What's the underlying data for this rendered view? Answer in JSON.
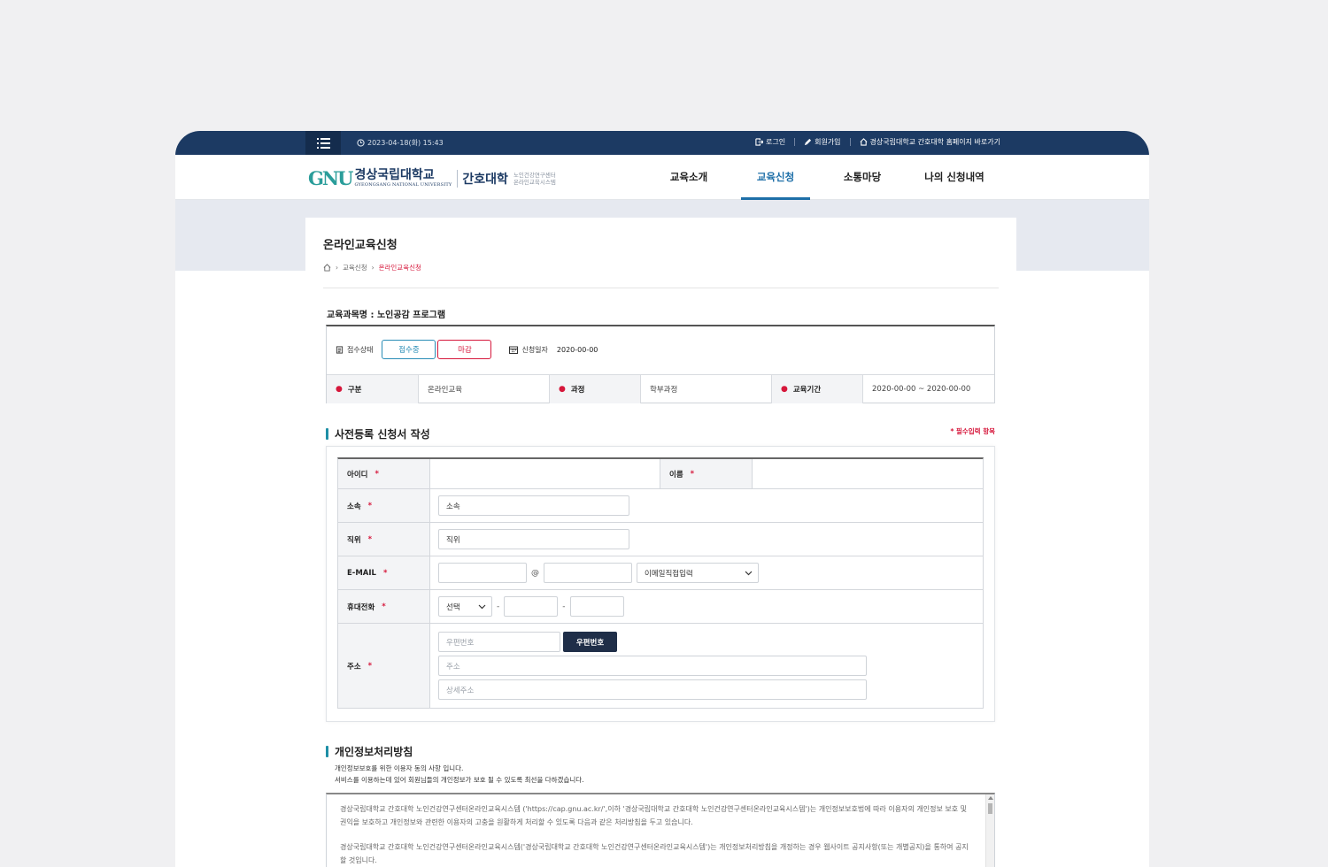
{
  "topbar": {
    "datetime": "2023-04-18(화) 15:43",
    "login": "로그인",
    "signup": "회원가입",
    "homepage": "경상국립대학교 간호대학 홈페이지 바로가기"
  },
  "header": {
    "logo_mark": "GNU",
    "logo_ko": "경상국립대학교",
    "logo_en": "GYEONGSANG NATIONAL UNIVERSITY",
    "college": "간호대학",
    "sub1": "노인건강연구센터",
    "sub2": "온라인교육시스템",
    "nav": [
      "교육소개",
      "교육신청",
      "소통마당",
      "나의 신청내역"
    ]
  },
  "page": {
    "title": "온라인교육신청",
    "breadcrumb": [
      "교육신청",
      "온라인교육신청"
    ]
  },
  "course": {
    "name": "교육과목명 : 노인공감 프로그램",
    "status_label": "접수상태",
    "status_open": "접수중",
    "status_closed": "마감",
    "reqdate_label": "신청일자",
    "reqdate_value": "2020-00-00",
    "type_label": "구분",
    "type_value": "온라인교육",
    "program_label": "과정",
    "program_value": "학부과정",
    "period_label": "교육기간",
    "period_value": "2020-00-00 ~ 2020-00-00"
  },
  "form": {
    "section_title": "사전등록 신청서 작성",
    "required_note": "* 필수입력 항목",
    "id_label": "아이디",
    "name_label": "이름",
    "affiliation_label": "소속",
    "affiliation_value": "소속",
    "position_label": "직위",
    "position_value": "직위",
    "email_label": "E-MAIL",
    "email_at": "@",
    "email_domain_select": "이메일직접입력",
    "phone_label": "휴대전화",
    "phone_select": "선택",
    "phone_dash": "-",
    "address_label": "주소",
    "zip_placeholder": "우편번호",
    "zip_button": "우편번호",
    "address_placeholder": "주소",
    "detail_placeholder": "상세주소",
    "star": "*"
  },
  "privacy": {
    "section_title": "개인정보처리방침",
    "desc1": "개인정보보호를 위한 이용자 동의 사항 입니다.",
    "desc2": "서비스를 이용하는데 있어 회원님들의 개인정보가 보호 될 수 있도록 최선을 다하겠습니다.",
    "para1": "경상국립대학교 간호대학 노인건강연구센터온라인교육시스템 ('https://cap.gnu.ac.kr/',이하 '경상국립대학교 간호대학 노인건강연구센터온라인교육시스템')는 개인정보보호법에 따라 이용자의 개인정보 보호 및 권익을 보호하고 개인정보와 관련한 이용자의 고충을 원활하게 처리할 수 있도록 다음과 같은 처리방침을 두고 있습니다.",
    "para2": "경상국립대학교 간호대학 노인건강연구센터온라인교육시스템('경상국립대학교 간호대학 노인건강연구센터온라인교육시스템')는 개인정보처리방침을 개정하는 경우 웹사이트 공지사항(또는 개별공지)을 통하여 공지할 것입니다."
  },
  "colors": {
    "navy": "#1c3a63",
    "accent": "#1e6fa8",
    "red": "#d6173b",
    "teal": "#2a9d9a"
  }
}
